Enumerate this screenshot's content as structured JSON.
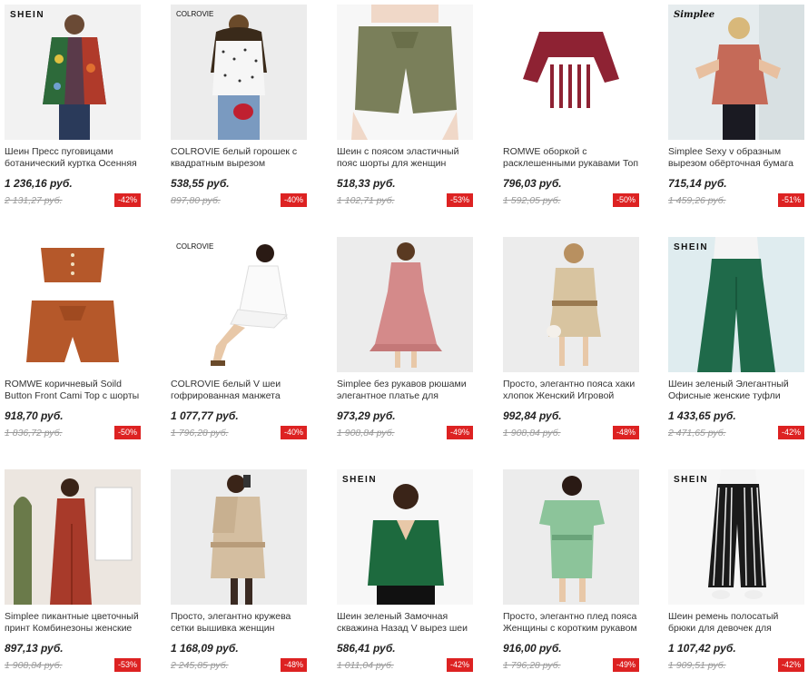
{
  "products": [
    {
      "brand": "SHEIN",
      "title": "Шеин Пресс пуговицами ботанический куртка Осенняя",
      "price": "1 236,16 руб.",
      "old_price": "2 131,27 руб.",
      "discount": "-42%"
    },
    {
      "brand": "COLROVIE",
      "title": "COLROVIE белый горошек с квадратным вырезом",
      "price": "538,55 руб.",
      "old_price": "897,80 руб.",
      "discount": "-40%"
    },
    {
      "brand": "",
      "title": "Шеин с поясом эластичный пояс шорты для женщин",
      "price": "518,33 руб.",
      "old_price": "1 102,71 руб.",
      "discount": "-53%"
    },
    {
      "brand": "",
      "title": "ROMWE оборкой с расклешенными рукавами Топ",
      "price": "796,03 руб.",
      "old_price": "1 592,05 руб.",
      "discount": "-50%"
    },
    {
      "brand": "Simplee",
      "title": "Simplee Sexy v образным вырезом обёрточная бумага",
      "price": "715,14 руб.",
      "old_price": "1 459,26 руб.",
      "discount": "-51%"
    },
    {
      "brand": "",
      "title": "ROMWE коричневый Soild Button Front Cami Top с шорты",
      "price": "918,70 руб.",
      "old_price": "1 836,72 руб.",
      "discount": "-50%"
    },
    {
      "brand": "COLROVIE",
      "title": "COLROVIE белый V шеи гофрированная манжета",
      "price": "1 077,77 руб.",
      "old_price": "1 796,28 руб.",
      "discount": "-40%"
    },
    {
      "brand": "",
      "title": "Simplee без рукавов рюшами элегантное платье для",
      "price": "973,29 руб.",
      "old_price": "1 908,84 руб.",
      "discount": "-49%"
    },
    {
      "brand": "",
      "title": "Просто, элегантно пояса хаки хлопок Женский Игровой",
      "price": "992,84 руб.",
      "old_price": "1 908,84 руб.",
      "discount": "-48%"
    },
    {
      "brand": "SHEIN",
      "title": "Шеин зеленый Элегантный Офисные женские туфли",
      "price": "1 433,65 руб.",
      "old_price": "2 471,65 руб.",
      "discount": "-42%"
    },
    {
      "brand": "",
      "title": "Simplee пикантные цветочный принт Комбинезоны женские",
      "price": "897,13 руб.",
      "old_price": "1 908,84 руб.",
      "discount": "-53%"
    },
    {
      "brand": "",
      "title": "Просто, элегантно кружева сетки вышивка женщин",
      "price": "1 168,09 руб.",
      "old_price": "2 245,85 руб.",
      "discount": "-48%"
    },
    {
      "brand": "SHEIN",
      "title": "Шеин зеленый Замочная скважина Назад V вырез шеи",
      "price": "586,41 руб.",
      "old_price": "1 011,04 руб.",
      "discount": "-42%"
    },
    {
      "brand": "",
      "title": "Просто, элегантно плед пояса Женщины с коротким рукавом",
      "price": "916,00 руб.",
      "old_price": "1 796,28 руб.",
      "discount": "-49%"
    },
    {
      "brand": "SHEIN",
      "title": "Шеин ремень полосатый брюки для девочек для",
      "price": "1 107,42 руб.",
      "old_price": "1 909,51 руб.",
      "discount": "-42%"
    }
  ],
  "colors": {
    "badge": "#dd2222",
    "price": "#222222",
    "old_price": "#999999"
  }
}
